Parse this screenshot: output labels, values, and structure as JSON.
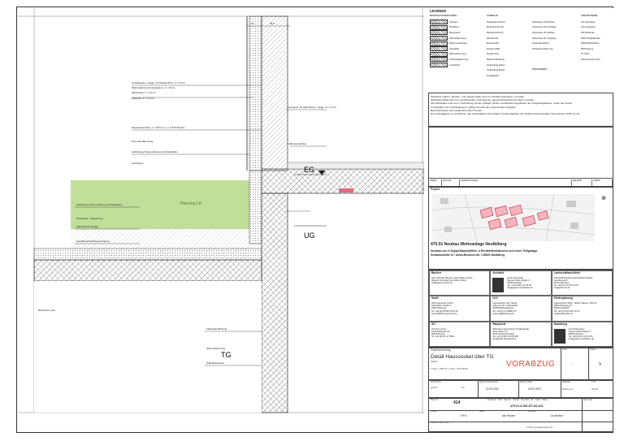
{
  "legend": {
    "title": "LEGENDE",
    "col1_title": "MATERIALSCHRAFFUREN",
    "col2_title": "SYMBOLIK",
    "col3_title": "ABKÜRZUNGEN",
    "materials": [
      "Ortbeton",
      "WU-Beton",
      "Mauerwerk",
      "Wärmedämmung",
      "Boden gewachsen",
      "Kies/Splitt",
      "Wärmedämmung",
      "Trittschalldämmung",
      "Luftschicht"
    ],
    "symbols": [
      "Deckendurchbruch",
      "Bodendurchbruch",
      "Wanddurchbruch",
      "Wandschlitz",
      "Bodenschlitz",
      "Deckenschlitz",
      "Brandschutz",
      "Wand-Verkleidung",
      "Verkleidung Decke",
      "Verkleidung Boden",
      "Fertigbauteil"
    ],
    "symbols2": [
      "Höhenkote OK Rohbau",
      "Höhenkote OK Fertigbau",
      "Höhenkote UK Rohbau",
      "Höhenkote UK Fertigbau",
      "Fußbodenaufbau",
      "Fußbodenaufbau neu"
    ],
    "abbreviations": [
      "OK Oberkante",
      "UK Unterkante",
      "RD Rohdecke",
      "FFB Fertigfußboden",
      "RFB Rohfußboden",
      "BR Brüstung",
      "ST Sturz",
      "DIN Deutsche Norm"
    ],
    "trockenbau_title": "TROCKENBAU"
  },
  "notes": {
    "lines": [
      "Sämtliche Höhen-, Breiten- und Längenmaße sind vor Ausführungsbeginn zu prüfen.",
      "Sämtliche Maße sind vom ausführenden Unternehmer eigenverantwortlich am Bau zu prüfen.",
      "Alle Werkpläne sind nur in Verbindung mit den gültigen Schal- und Bewehrungsplänen des Tragwerksplaners, sowie den Durch-",
      "bruchsplänen der Fachingenieure gültig und sind den ergänzenden Angaben.",
      "Beschreibungen der bauausführenden Firmen.",
      "Der Auftraggeber ist verpflichtet, den Auftraggeber auf etwaige Unstimmigkeiten der Ausführungsunterlagen hinzuweisen (VOB, § 3.3)."
    ],
    "index_cols": [
      "INDEX",
      "DATUM",
      "ÄNDERUNGEN",
      "BEARB.",
      "GEPR."
    ]
  },
  "project": {
    "label": "Projekt",
    "number": "470.01 Neubau Wohnanlage Neulblberg",
    "desc": "Neubau von 6 Doppelhaushälften, 3 Einfamilienhäusern und einer Tiefgarage",
    "address": "Sebaldusstraße 19 / Anton-Bruckner-Str. 2 85521 Neulblberg"
  },
  "parties": [
    {
      "role": "Bauherr",
      "text": [
        "Gebr. Michael Mayerle, Hans Ralph Schaub",
        "Mayerle & Schaub Immobilien GmbH",
        "info@gpjure-schulz.de"
      ]
    },
    {
      "role": "Architekt",
      "text": [
        "Gerd Hohenstein",
        "Sperser Welter Bogen 6",
        "81829 München",
        "Tel. +49 (0) 89 1 20 44 63",
        "info@gpjure-architekten.de"
      ]
    },
    {
      "role": "Landschaftsarchitekt",
      "text": [
        "Fabrikhoff-Renard Landschaftsarchitekten",
        "Kapellenweg 5",
        "81371 München",
        "Tel. +49 (0) 170 972 24 22",
        "info@plan-lps.de"
      ]
    },
    {
      "role": "Statik",
      "text": [
        "HPS Ingenieure GmbH",
        "Schmiedstr. Straße 1",
        "81827 München",
        "Tel. +49 (0) 89 820 26 59 10",
        "buero@HPS-Ingenieure.de"
      ]
    },
    {
      "role": "HLS",
      "text": [
        "Ingenieurbüro Ivan Tandru",
        "Lisburner Str. 3 Wiesbaden",
        "63225 Wolfratshausen",
        "Tel. +49 (0) 172 8560 377",
        "planung@itplanung.de"
      ]
    },
    {
      "role": "Elektroplanung",
      "text": [
        "Ingenieurbüro Wolff · Talhas, Wasser, Technik",
        "Mittenhofenweg 22",
        "82064 Straßlach",
        "Tel. +49 (0) 8170 997 63 13",
        "info@wolff-gmbh.de"
      ]
    },
    {
      "role": "SLT",
      "text": [
        "Thiersch Günter",
        "Harsukoffstraße 3a",
        "83043 Pinsing",
        "Tel. +49 (0) 81 21 73903"
      ]
    },
    {
      "role": "Bauphysik",
      "text": [
        "Walmsfee Ingenieurbüro für Bauphysik",
        "Hofer Weiler 12",
        "82347 Deutschenhofen",
        "Tel. +49 (0) 8171 09 95 995",
        "info@walm-bauphysik.de"
      ]
    },
    {
      "role": "Bauleitung",
      "text": [
        "Gerd Hohenstein",
        "Sperser Welter Bogen 6",
        "81829 München",
        "Tel. +49 (0) 89 1 20 44 63",
        "info@gpjure-architekten.de"
      ]
    }
  ],
  "title_block": {
    "plan_label": "Planbezeichnung",
    "plan_title": "Detail Haussockel über TG",
    "plan_sub": "Details",
    "height_ref": "± 0,00 = +552,75 m ü NN = OK FFB EG",
    "stamp": "VORABZUG",
    "index_label": "Index",
    "index_value": "-",
    "status_label": "Status",
    "status_value": "V",
    "gezeichnet_label": "gezeichnet",
    "gezeichnet_value": "geprüft",
    "kuerzel": "KU",
    "datum_erst_label": "Datum Erstausgabe",
    "datum_erst": "02.08.2022",
    "datum_stand_label": "Datum Stand",
    "datum_stand": "09.08.2022",
    "massstab_label": "Maßstab",
    "massstab": "1:10",
    "format_label": "Planformat",
    "format": "DIN A2",
    "plan_nr_label": "Plan Nr.",
    "plan_nr": "414",
    "code_row1": "Projekt Nr. · LPH · Haus Nr. · Planart · Geschoss · Nr. · Index · Status",
    "code_row2": "470-01-5-ISS-DT-XX-414",
    "phase_label": "Phase",
    "phase": "LPH 5",
    "haus_label": "Haus",
    "haus": "alle Häuser",
    "ersteller_label": "Ersteller",
    "ersteller": "Architektur",
    "file_label": "Planna. Datei (.pln)",
    "file": "470-01_Ausnahmetypen.pln",
    "qr_label": "QR-Code"
  },
  "drawing": {
    "eg_label": "EG",
    "ug_label": "UG",
    "tg_label": "TG",
    "planung_la": "Planung LA",
    "notes_top": [
      "Putzfassade, 2-lagig, mit Farbanstrich, d = 2,5 cm",
      "Wärmedämmverbundsystem, d = 16 cm",
      "Mauerwerk, d = 24 cm",
      "Gipsputz, d = 1,5 cm"
    ],
    "notes_mid": [
      "Ziegelmauerwerk, d = 36,5 cm, λ = 0,070 W/(mK)",
      "Perimeterdämmung",
      "Abdichtung Polymerbitumen-Schweißbahn",
      "Sockelputz"
    ],
    "notes_left": [
      "Abdichtung Polymerbitumen-Schweißbahn",
      "Oberboden · Begrünung",
      "Filtervlies/Trennlage",
      "Kiesfilterschicht/Kiesschüttung"
    ],
    "note_bottom": [
      "Flachdachdichtung",
      "Wärmedämmung",
      "Stahlbetondecke"
    ],
    "note_right": [
      "Innenputz mit Glanzfarbe, 1-lagig, d = 1,5 cm",
      "Fußbodenaufbau"
    ],
    "rfb_label": "RD-Decke (UG)",
    "dims": [
      "30",
      "36,5",
      "16",
      "25"
    ]
  },
  "colors": {
    "green_fill": "#b9dc8e",
    "stamp_red": "#e0443a",
    "red_marker": "#e26a7e"
  }
}
